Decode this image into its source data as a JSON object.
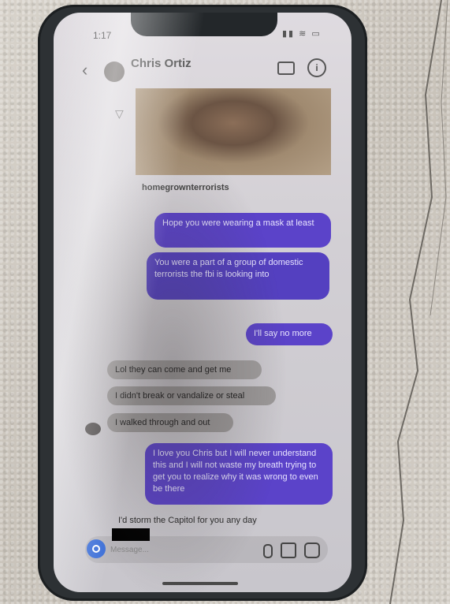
{
  "status": {
    "time": "1:17",
    "icons": "▮▮ ≋ ▭"
  },
  "header": {
    "back_icon": "‹",
    "contact_name": "Chris Ortiz",
    "contact_username": "",
    "info_icon": "i"
  },
  "shared_post": {
    "caption": "homegrownterrorists",
    "sub": ""
  },
  "reaction_icon": "▽",
  "messages": {
    "m1": "Hope you were wearing a mask at least",
    "m2": "You were a part of a group of domestic terrorists the fbi is looking into",
    "m3": "I'll say no more",
    "r1": "Lol they can come and get me",
    "r2": "I didn't break or vandalize or steal",
    "r3": "I walked through and out",
    "m4": "I love you Chris but I will never understand this and I will not waste my breath trying to get you to realize why it was wrong to even be there",
    "r4": "I'd storm the Capitol for you any day"
  },
  "composer": {
    "placeholder": "Message..."
  },
  "colors": {
    "outgoing": "#5b43c9",
    "incoming": "#9d9a9a",
    "phone": "#2d3134"
  }
}
